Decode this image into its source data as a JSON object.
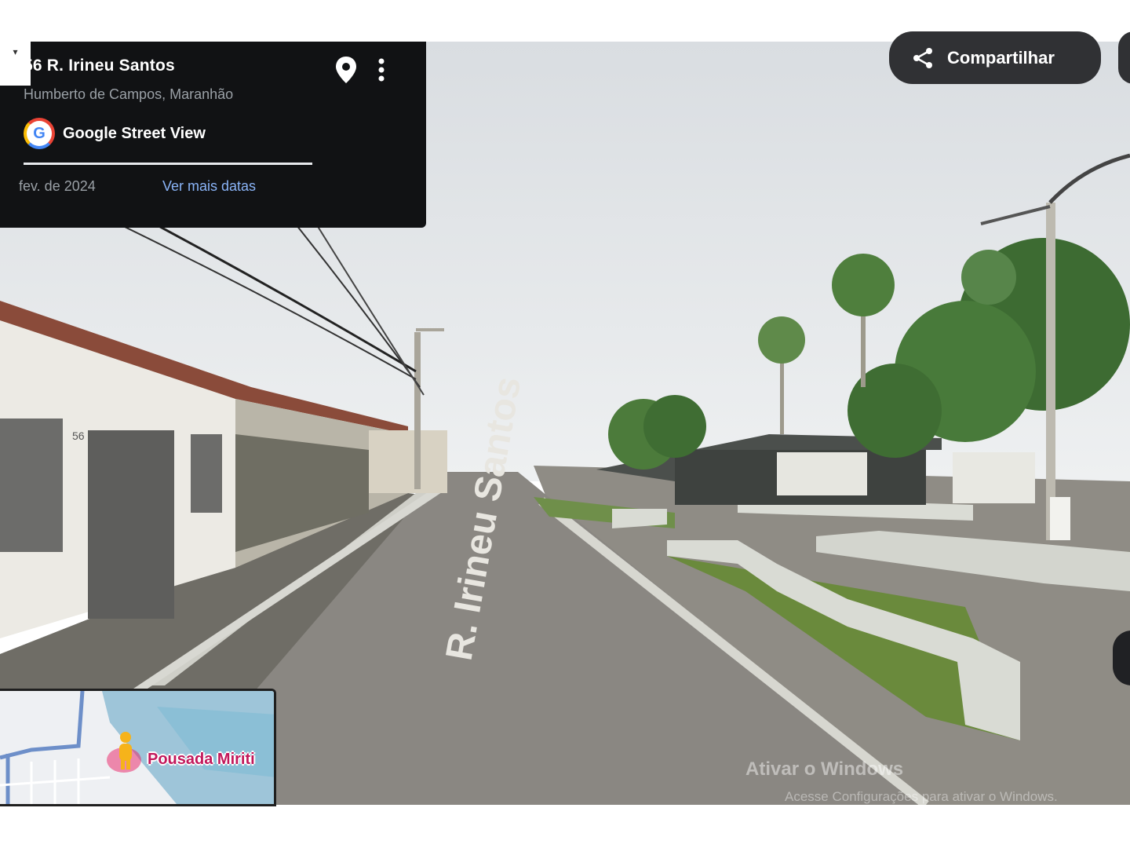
{
  "location": {
    "title": "56 R. Irineu Santos",
    "subtitle": "Humberto de Campos, Maranhão",
    "brand": "Google Street View",
    "capture_date": "fev. de 2024",
    "more_dates_label": "Ver mais datas"
  },
  "toolbar": {
    "share_label": "Compartilhar"
  },
  "minimap": {
    "place_label": "Pousada Miriti"
  },
  "scene": {
    "street_marking": "R. Irineu Santos",
    "house_number": "56"
  },
  "overlay": {
    "watermark": "Ativar o Windows",
    "watermark_sub": "Acesse Configurações para ativar o Windows."
  },
  "colors": {
    "card_bg": "#111214",
    "link": "#8ab4f8",
    "button_bg": "#303134",
    "place_label": "#c2185b"
  },
  "icons": {
    "pin": "location-pin-icon",
    "more": "more-vert-icon",
    "share": "share-icon",
    "google": "google-logo-icon",
    "pegman": "pegman-icon"
  }
}
